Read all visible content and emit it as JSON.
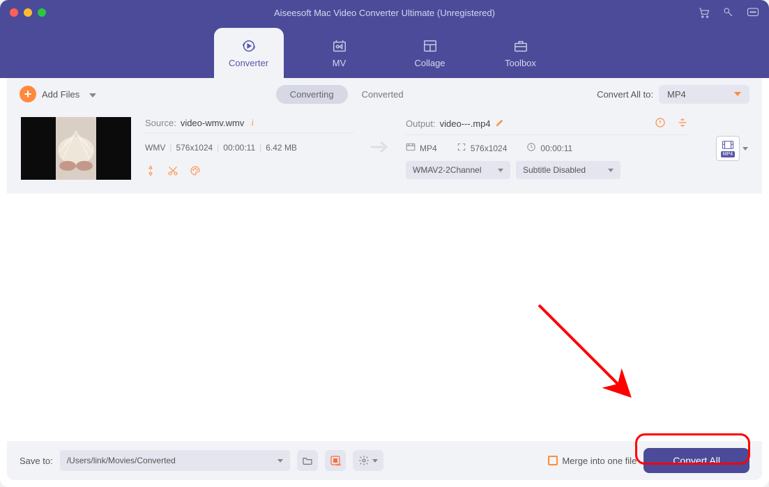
{
  "title": "Aiseesoft Mac Video Converter Ultimate (Unregistered)",
  "tabs": {
    "converter": "Converter",
    "mv": "MV",
    "collage": "Collage",
    "toolbox": "Toolbox"
  },
  "toolbar": {
    "add_files": "Add Files",
    "converting": "Converting",
    "converted": "Converted",
    "convert_all_to_label": "Convert All to:",
    "convert_all_format": "MP4"
  },
  "file": {
    "source_label": "Source:",
    "source_name": "video-wmv.wmv",
    "src_format": "WMV",
    "src_res": "576x1024",
    "src_dur": "00:00:11",
    "src_size": "6.42 MB",
    "output_label": "Output:",
    "output_name": "video---.mp4",
    "out_format": "MP4",
    "out_res": "576x1024",
    "out_dur": "00:00:11",
    "audio_sel": "WMAV2-2Channel",
    "subtitle_sel": "Subtitle Disabled",
    "format_badge": "MP4"
  },
  "bottom": {
    "save_to_label": "Save to:",
    "save_to_path": "/Users/link/Movies/Converted",
    "merge_label": "Merge into one file",
    "convert_all_btn": "Convert All"
  },
  "colors": {
    "brand": "#4b4b9a",
    "accent": "#ff8a3d",
    "annotation": "#ff0000"
  }
}
